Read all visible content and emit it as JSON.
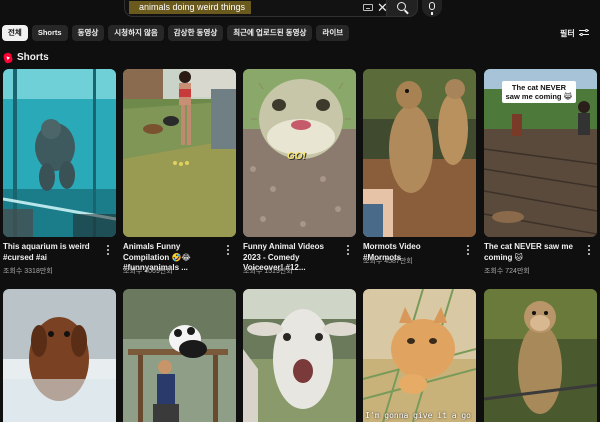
{
  "search": {
    "query": "animals doing weird things"
  },
  "chips": [
    "전체",
    "Shorts",
    "동영상",
    "시청하지 않음",
    "감상한 동영상",
    "최근에 업로드된 동영상",
    "라이브"
  ],
  "filter_label": "필터",
  "section": {
    "title": "Shorts"
  },
  "shorts": [
    {
      "title": "This aquarium is weird #cursed #ai",
      "views": "조회수 3318만회"
    },
    {
      "title": "Animals Funny Compilation 🤣😂 #funnyanimals ...",
      "views": "조회수 4069만회"
    },
    {
      "title": "Funny Animal Videos 2023 - Comedy Voiceover! #12...",
      "views": "조회수 1519만회"
    },
    {
      "title": "Mormots Video #Mormots",
      "views": "조회수 4587만회"
    },
    {
      "title": "The cat NEVER saw me coming 🐱",
      "views": "조회수 724만회"
    }
  ],
  "overlays": {
    "cat_caption": "The cat NEVER saw me coming 😹",
    "go_text": "GO!",
    "subtitle": "I'm gonna give it a go"
  },
  "colors": {
    "background": "#0f0f0f",
    "chip": "#272727",
    "chip_active": "#f1f1f1",
    "shorts_red": "#ff0033",
    "search_highlight": "#6b5a1e"
  }
}
